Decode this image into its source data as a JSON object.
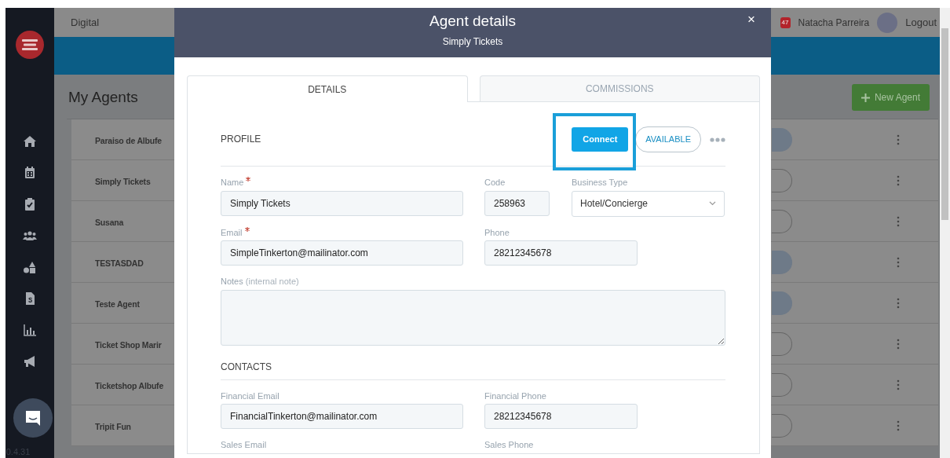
{
  "topbar": {
    "brand": "Digital",
    "notification_count": "47",
    "user_name": "Natacha Parreira",
    "logout": "Logout"
  },
  "sidebar": {
    "version": "0.4.31"
  },
  "page": {
    "title": "My Agents",
    "new_button": "New Agent"
  },
  "agents": [
    {
      "name": "Paraiso de Albufe",
      "on": true
    },
    {
      "name": "Simply Tickets",
      "on": false
    },
    {
      "name": "Susana",
      "on": false
    },
    {
      "name": "TESTASDAD",
      "on": true
    },
    {
      "name": "Teste Agent",
      "on": true
    },
    {
      "name": "Ticket Shop Marir",
      "on": false
    },
    {
      "name": "Ticketshop Albufe",
      "on": false
    },
    {
      "name": "Tripit Fun",
      "on": false
    }
  ],
  "modal": {
    "title": "Agent details",
    "subtitle": "Simply Tickets",
    "close": "×",
    "tabs": [
      {
        "label": "DETAILS",
        "selected": true
      },
      {
        "label": "COMMISSIONS",
        "selected": false
      }
    ],
    "profile": {
      "heading": "PROFILE",
      "connect": "Connect",
      "status": "AVAILABLE",
      "rows": [
        [
          {
            "label": "Name",
            "required": true,
            "kind": "input",
            "value": "Simply Tickets"
          },
          {
            "label": "Code",
            "required": false,
            "kind": "input",
            "value": "258963"
          },
          {
            "label": "Business Type",
            "required": false,
            "kind": "select",
            "value": "Hotel/Concierge"
          }
        ],
        [
          {
            "label": "Email",
            "required": true,
            "kind": "input",
            "value": "SimpleTinkerton@mailinator.com"
          },
          {
            "label": "Phone",
            "required": false,
            "kind": "input",
            "value": "28212345678"
          }
        ]
      ],
      "notes": {
        "label": "Notes",
        "hint": "(internal note)"
      }
    },
    "contacts": {
      "heading": "CONTACTS",
      "rows": [
        [
          {
            "label": "Financial Email",
            "required": false,
            "kind": "input",
            "value": "FinancialTinkerton@mailinator.com"
          },
          {
            "label": "Financial Phone",
            "required": false,
            "kind": "input",
            "value": "28212345678"
          }
        ],
        [
          {
            "label": "Sales Email",
            "required": false,
            "kind": "label"
          },
          {
            "label": "Sales Phone",
            "required": false,
            "kind": "label"
          }
        ]
      ]
    }
  }
}
